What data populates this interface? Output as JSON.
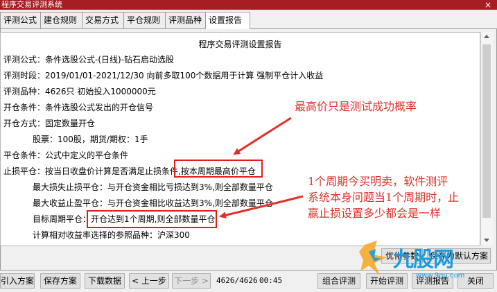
{
  "window": {
    "title": "程序交易评测系统",
    "close_label": "×"
  },
  "tabs": [
    {
      "label": "评测公式"
    },
    {
      "label": "建仓规则"
    },
    {
      "label": "交易方式"
    },
    {
      "label": "平仓规则"
    },
    {
      "label": "评测品种"
    },
    {
      "label": "设置报告"
    }
  ],
  "active_tab": "设置报告",
  "report": {
    "title": "程序交易评测设置报告",
    "lines": [
      "评测公式：条件选股公式-(日线)-钻石启动选股",
      "评测时段：2019/01/01-2021/12/30 向前多取100个数据用于计算 强制平仓计入收益",
      "评测品种：4626只 初始投入1000000元",
      "开仓条件：条件选股公式发出的开仓信号",
      "开仓方式：固定数量开仓",
      "股票：100股，期货/期权：1手",
      "平仓条件：公式中定义的平仓条件",
      "止损平仓：按当日收盘价计算是否满足止损条件,按本周期最高价平仓",
      "最大损失止损平仓：与开仓资金相比亏损达到3%,则全部数量平仓",
      "最大收益止盈平仓：与开仓资金相比收益达到3%,则全部数量平仓",
      "目标周期平仓：开仓达到1个周期,则全部数量平仓",
      "计算相对收益率选择的参照品种：沪深300"
    ]
  },
  "panel_buttons": {
    "optimize": "优化参数",
    "save_default": "保存为默认方案"
  },
  "bottom_buttons": {
    "import": "引入方案",
    "save": "保存方案",
    "download": "下载数据",
    "prev": "< 上一步",
    "next": "下一步 >",
    "combo": "组合评测",
    "start": "开始评测",
    "report": "评测报告",
    "close": "关闭"
  },
  "status": {
    "progress": "4626/4626",
    "time": "00:45"
  },
  "annotations": {
    "top": "最高价只是测试成功概率",
    "bottom": [
      "1个周期今买明卖，软件测评",
      "系统本身问题当1个周期时，止",
      "赢止损设置多少都会是一样"
    ]
  },
  "watermark": {
    "text": "九股网",
    "url": "www.9gu.com"
  },
  "colors": {
    "title_bar": "#a61d24",
    "annotation": "#e0302a",
    "watermark": "#1a9be0"
  }
}
